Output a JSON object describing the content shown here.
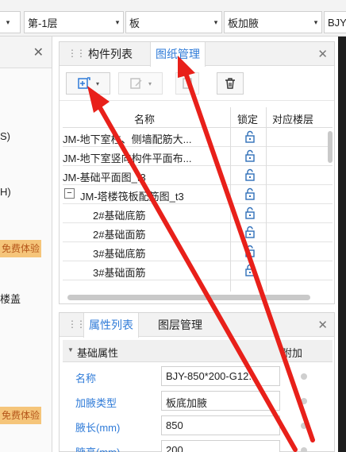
{
  "toolbar": {
    "floor_partial_arrow": "▾",
    "floor": "第-1层",
    "category": "板",
    "component": "板加腋",
    "element_partial": "BJY"
  },
  "left_panel": {
    "line1": "S)",
    "line2": "H)",
    "badge1": "免费体验",
    "line3": "楼盖",
    "badge2": "免费体验"
  },
  "panel_top": {
    "tabs": [
      {
        "label": "构件列表"
      },
      {
        "label": "图纸管理"
      }
    ],
    "columns": {
      "name": "名称",
      "lock": "锁定",
      "floor": "对应楼层"
    },
    "rows": [
      {
        "name": "JM-地下室柱、侧墙配筋大...",
        "indent": 0
      },
      {
        "name": "JM-地下室竖向构件平面布...",
        "indent": 0
      },
      {
        "name": "JM-基础平面图_t3",
        "indent": 0
      },
      {
        "name": "JM-塔楼筏板配筋图_t3",
        "indent": 0,
        "expander": "−"
      },
      {
        "name": "2#基础底筋",
        "indent": 1
      },
      {
        "name": "2#基础面筋",
        "indent": 1
      },
      {
        "name": "3#基础底筋",
        "indent": 1
      },
      {
        "name": "3#基础面筋",
        "indent": 1
      }
    ]
  },
  "panel_bottom": {
    "tabs": [
      {
        "label": "属性列表"
      },
      {
        "label": "图层管理"
      }
    ],
    "section_title": "基础属性",
    "extra_header": "附加",
    "properties": [
      {
        "label": "名称",
        "value": "BJY-850*200-G12..."
      },
      {
        "label": "加腋类型",
        "value": "板底加腋"
      },
      {
        "label": "腋长(mm)",
        "value": "850"
      },
      {
        "label": "腋高(mm)",
        "value": "200"
      }
    ]
  },
  "colors": {
    "accent": "#2f7bd8",
    "arrow": "#e8201a",
    "badge_bg": "#f5c57a"
  }
}
